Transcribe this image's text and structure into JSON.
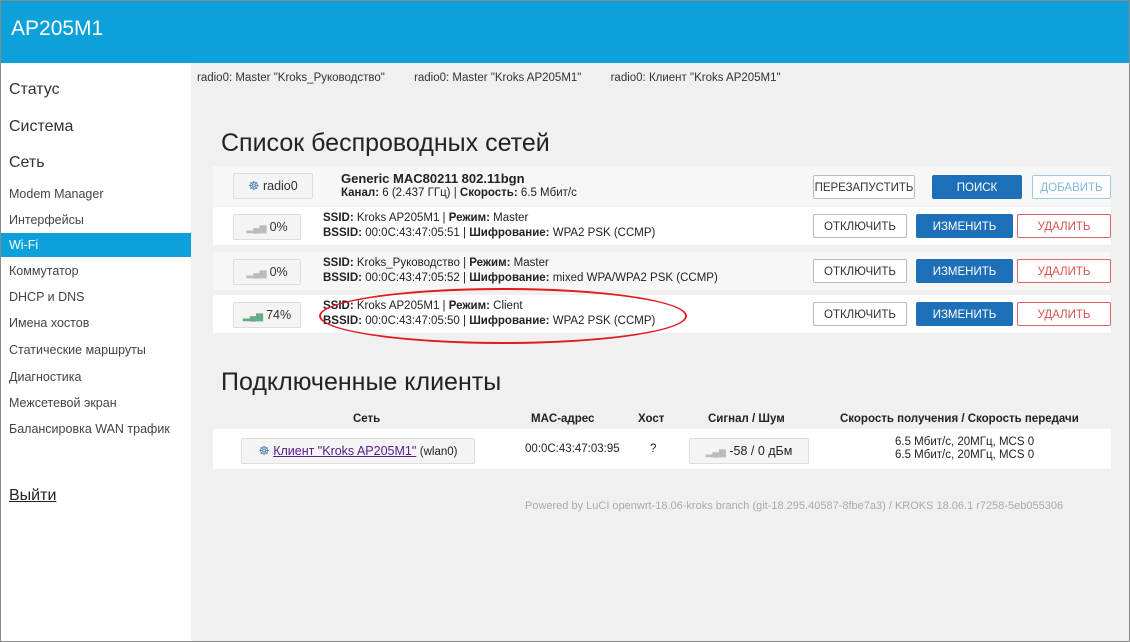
{
  "app": {
    "title": "AP205M1"
  },
  "sidebar": {
    "top_items": [
      "Статус",
      "Система",
      "Сеть"
    ],
    "sub_items": [
      "Modem Manager",
      "Интерфейсы",
      "Wi-Fi",
      "Коммутатор",
      "DHCP и DNS",
      "Имена хостов",
      "Статические маршруты",
      "Диагностика",
      "Межсетевой экран",
      "Балансировка WAN трафик"
    ],
    "active_item": "Wi-Fi",
    "logout": "Выйти"
  },
  "tabs": [
    "radio0: Master \"Kroks_Руководство\"",
    "radio0: Master \"Kroks AP205M1\"",
    "radio0: Клиент \"Kroks AP205M1\""
  ],
  "wireless": {
    "heading": "Список беспроводных сетей",
    "device": {
      "button": "radio0",
      "name": "Generic MAC80211 802.11bgn",
      "channel_label": "Канал:",
      "channel_value": "6 (2.437 ГГц)",
      "speed_label": "Скорость:",
      "speed_value": "6.5 Мбит/с",
      "actions": [
        "ПЕРЕЗАПУСТИТЬ",
        "ПОИСК",
        "ДОБАВИТЬ"
      ]
    },
    "networks": [
      {
        "signal": "0%",
        "ssid": "Kroks AP205M1",
        "mode": "Master",
        "bssid": "00:0C:43:47:05:51",
        "encryption": "WPA2 PSK (CCMP)"
      },
      {
        "signal": "0%",
        "ssid": "Kroks_Руководство",
        "mode": "Master",
        "bssid": "00:0C:43:47:05:52",
        "encryption": "mixed WPA/WPA2 PSK (CCMP)"
      },
      {
        "signal": "74%",
        "ssid": "Kroks AP205M1",
        "mode": "Client",
        "bssid": "00:0C:43:47:05:50",
        "encryption": "WPA2 PSK (CCMP)"
      }
    ],
    "labels": {
      "ssid": "SSID:",
      "mode": "Режим:",
      "bssid": "BSSID:",
      "encryption": "Шифрование:"
    },
    "row_actions": [
      "ОТКЛЮЧИТЬ",
      "ИЗМЕНИТЬ",
      "УДАЛИТЬ"
    ]
  },
  "clients": {
    "heading": "Подключенные клиенты",
    "columns": [
      "Сеть",
      "MAC-адрес",
      "Хост",
      "Сигнал / Шум",
      "Скорость получения / Скорость передачи"
    ],
    "rows": [
      {
        "network_link": "Клиент \"Kroks AP205M1\"",
        "iface": "(wlan0)",
        "mac": "00:0C:43:47:03:95",
        "host": "?",
        "signal": "-58 / 0 дБм",
        "rate_rx": "6.5 Мбит/с, 20МГц, MCS 0",
        "rate_tx": "6.5 Мбит/с, 20МГц, MCS 0"
      }
    ]
  },
  "footer": "Powered by LuCI openwrt-18.06-kroks branch (git-18.295.40587-8fbe7a3) / KROKS 18.06.1 r7258-5eb055306",
  "colors": {
    "header": "#0ca1d9",
    "primary_button": "#1d6fb8",
    "danger": "#d9534f",
    "annotation": "#e01b1b"
  }
}
